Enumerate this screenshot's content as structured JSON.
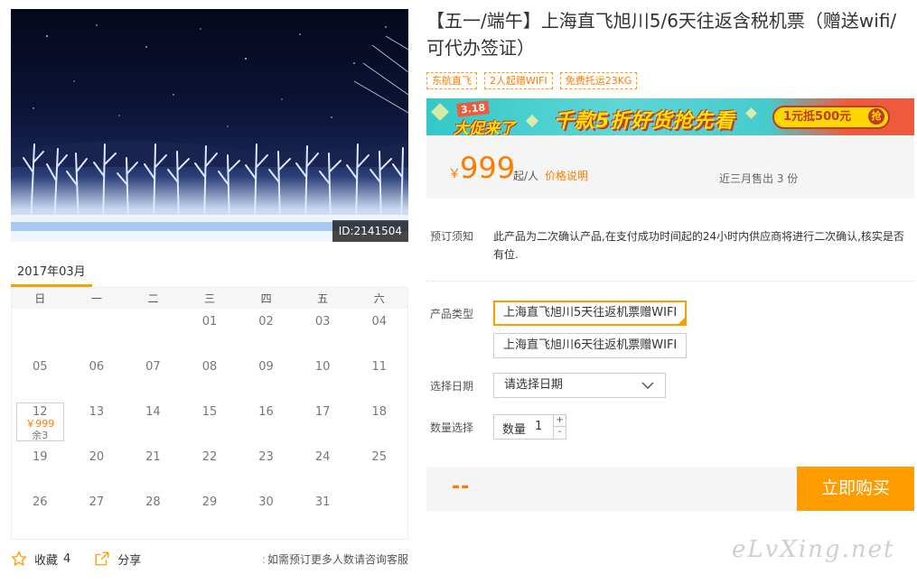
{
  "hero": {
    "id_label": "ID:2141504"
  },
  "calendar": {
    "month": "2017年03月",
    "weekdays": [
      "日",
      "一",
      "二",
      "三",
      "四",
      "五",
      "六"
    ],
    "days": [
      "",
      "",
      "",
      "01",
      "02",
      "03",
      "04",
      "05",
      "06",
      "07",
      "08",
      "09",
      "10",
      "11",
      "12",
      "13",
      "14",
      "15",
      "16",
      "17",
      "18",
      "19",
      "20",
      "21",
      "22",
      "23",
      "24",
      "25",
      "26",
      "27",
      "28",
      "29",
      "30",
      "31",
      ""
    ],
    "active_day": {
      "day": "12",
      "price": "￥999",
      "remaining": "余3"
    }
  },
  "footer": {
    "favorite_label": "收藏",
    "favorite_count": "4",
    "share_label": "分享",
    "consult_text": "如需预订更多人数请咨询客服"
  },
  "product": {
    "title": "【五一/端午】上海直飞旭川5/6天往返含税机票（赠送wifi/可代办签证）",
    "tags": [
      "东航直飞",
      "2人起赠WIFI",
      "免费托运23KG"
    ]
  },
  "banner": {
    "date": "3.18",
    "slogan": "大促来了",
    "headline": "千款5折好货抢先看",
    "coupon": "1元抵500元",
    "grab": "抢"
  },
  "price": {
    "currency": "￥",
    "amount": "999",
    "unit": "起/人",
    "explain_link": "价格说明",
    "sold": "近三月售出 3 份"
  },
  "booking_notice": {
    "label": "预订须知",
    "text": "此产品为二次确认产品,在支付成功时间起的24小时内供应商将进行二次确认,核实是否有位."
  },
  "options": {
    "type_label": "产品类型",
    "types": [
      "上海直飞旭川5天往返机票赠WIFI",
      "上海直飞旭川6天往返机票赠WIFI"
    ],
    "date_label": "选择日期",
    "date_placeholder": "请选择日期",
    "qty_label": "数量选择",
    "qty_inner_label": "数量",
    "qty_value": "1",
    "qty_plus": "+",
    "qty_minus": "-"
  },
  "buy": {
    "total": "--",
    "button": "立即购买"
  },
  "watermark": "eLvXing.net"
}
